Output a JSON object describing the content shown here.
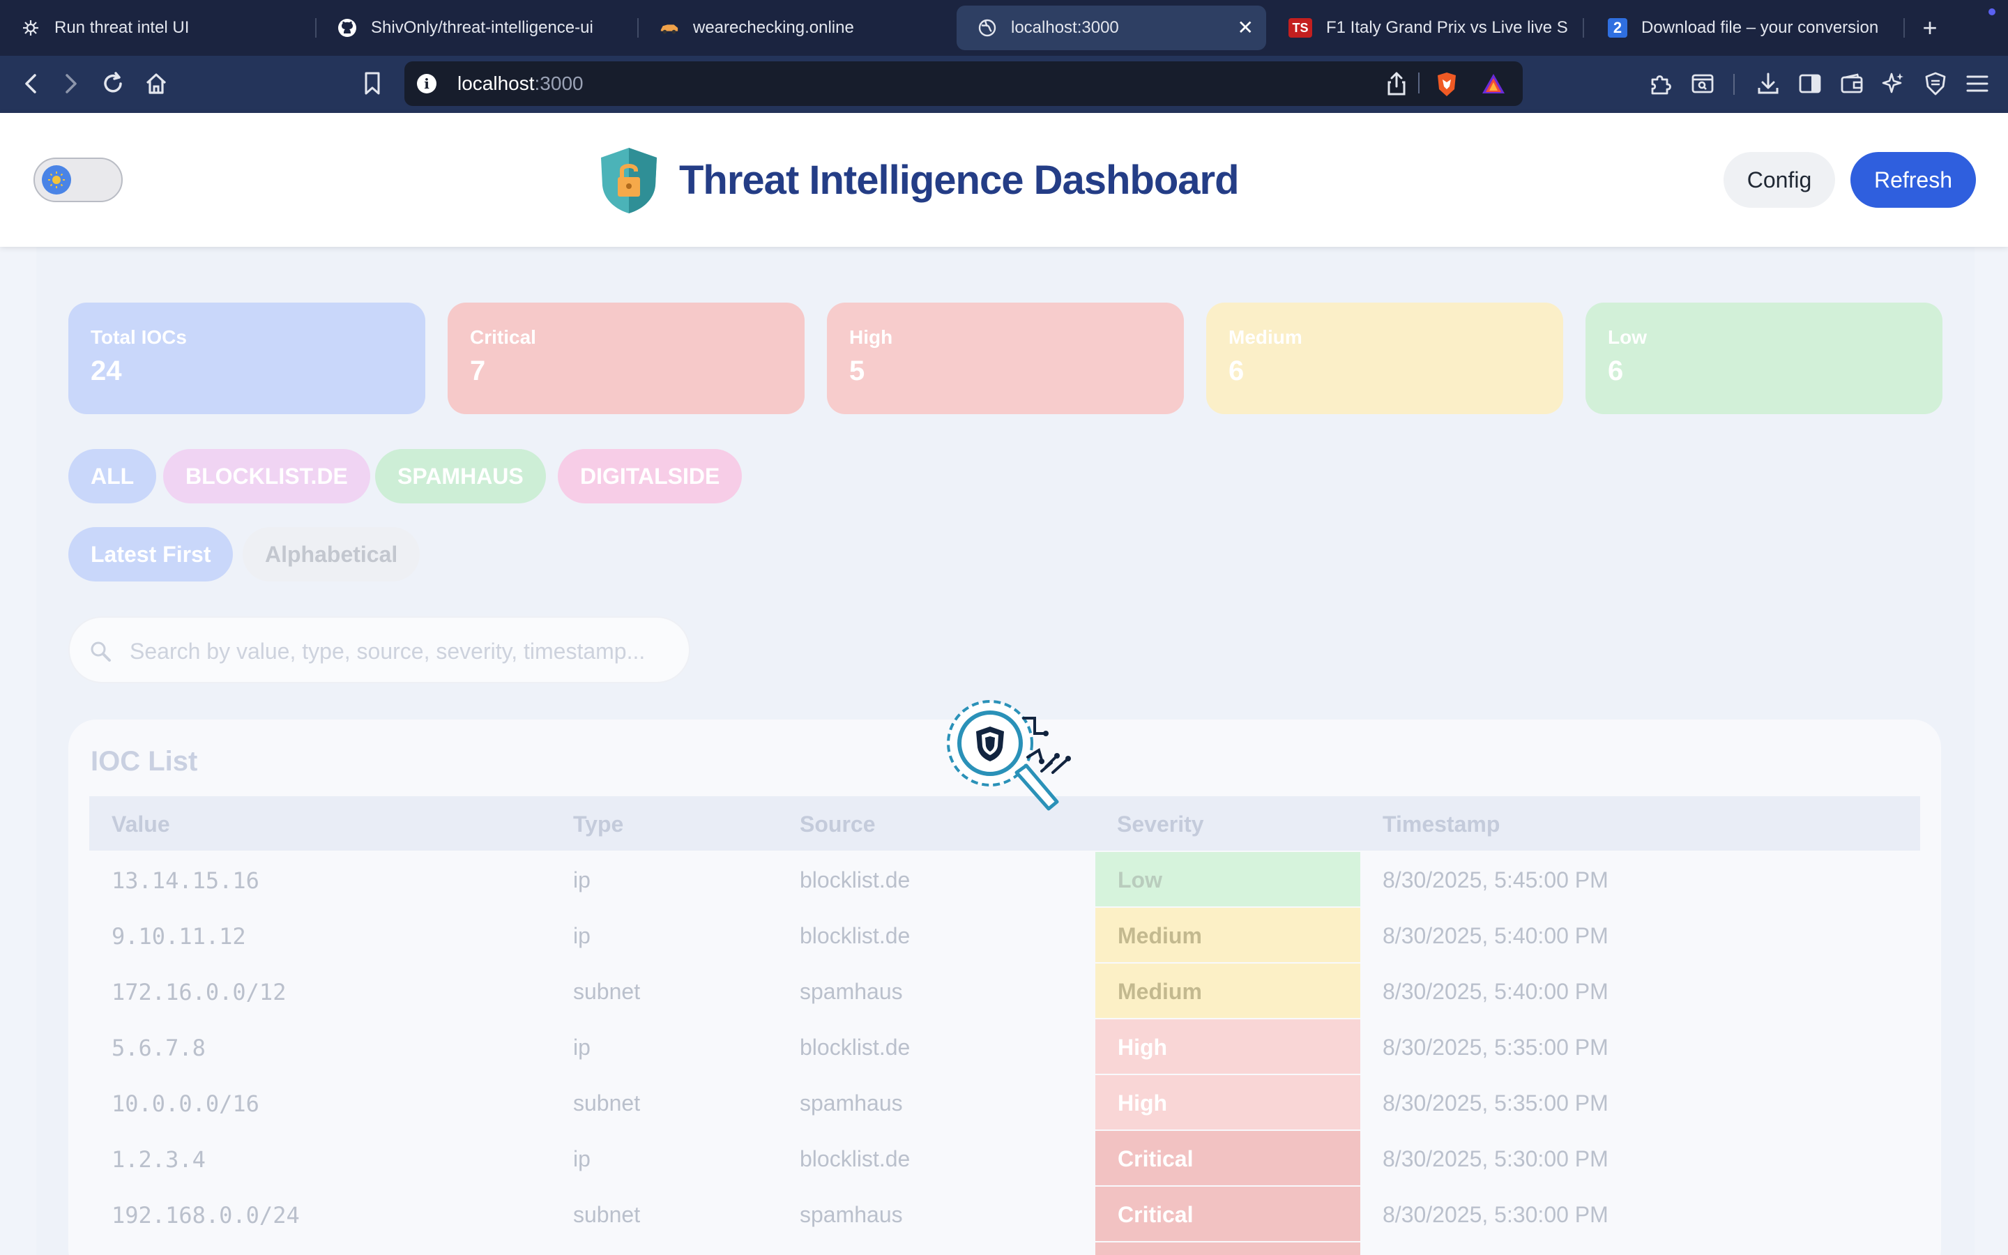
{
  "browser": {
    "tabs": [
      {
        "title": "Run threat intel UI",
        "icon": "openai-icon"
      },
      {
        "title": "ShivOnly/threat-intelligence-ui",
        "icon": "github-icon"
      },
      {
        "title": "wearechecking.online",
        "icon": "car-icon"
      },
      {
        "title": "localhost:3000",
        "icon": "globe-icon",
        "active": true
      },
      {
        "title": "F1 Italy Grand Prix vs Live live S",
        "icon": "ts-icon"
      },
      {
        "title": "Download file – your conversion",
        "icon": "download-2-icon"
      }
    ],
    "url_host": "localhost",
    "url_port": ":3000",
    "ts_badge": "TS",
    "two_badge": "2"
  },
  "header": {
    "title": "Threat Intelligence Dashboard",
    "config_label": "Config",
    "refresh_label": "Refresh"
  },
  "stats": [
    {
      "label": "Total IOCs",
      "value": "24",
      "color": "#c9d7fa"
    },
    {
      "label": "Critical",
      "value": "7",
      "color": "#f6c9c9"
    },
    {
      "label": "High",
      "value": "5",
      "color": "#f7cccc"
    },
    {
      "label": "Medium",
      "value": "6",
      "color": "#fbefc8"
    },
    {
      "label": "Low",
      "value": "6",
      "color": "#d2f0d8"
    }
  ],
  "source_filters": [
    "ALL",
    "BLOCKLIST.DE",
    "SPAMHAUS",
    "DIGITALSIDE"
  ],
  "sort_options": [
    "Latest First",
    "Alphabetical"
  ],
  "search": {
    "placeholder": "Search by value, type, source, severity, timestamp..."
  },
  "ioc_list": {
    "title": "IOC List",
    "columns": [
      "Value",
      "Type",
      "Source",
      "Severity",
      "Timestamp"
    ],
    "rows": [
      {
        "value": "13.14.15.16",
        "type": "ip",
        "source": "blocklist.de",
        "severity": "Low",
        "timestamp": "8/30/2025, 5:45:00 PM"
      },
      {
        "value": "9.10.11.12",
        "type": "ip",
        "source": "blocklist.de",
        "severity": "Medium",
        "timestamp": "8/30/2025, 5:40:00 PM"
      },
      {
        "value": "172.16.0.0/12",
        "type": "subnet",
        "source": "spamhaus",
        "severity": "Medium",
        "timestamp": "8/30/2025, 5:40:00 PM"
      },
      {
        "value": "5.6.7.8",
        "type": "ip",
        "source": "blocklist.de",
        "severity": "High",
        "timestamp": "8/30/2025, 5:35:00 PM"
      },
      {
        "value": "10.0.0.0/16",
        "type": "subnet",
        "source": "spamhaus",
        "severity": "High",
        "timestamp": "8/30/2025, 5:35:00 PM"
      },
      {
        "value": "1.2.3.4",
        "type": "ip",
        "source": "blocklist.de",
        "severity": "Critical",
        "timestamp": "8/30/2025, 5:30:00 PM"
      },
      {
        "value": "192.168.0.0/24",
        "type": "subnet",
        "source": "spamhaus",
        "severity": "Critical",
        "timestamp": "8/30/2025, 5:30:00 PM"
      }
    ]
  },
  "colors": {
    "accent": "#2f5fde",
    "title": "#243d86",
    "sev_low": "#d6f3dc",
    "sev_medium": "#fcf0c6",
    "sev_high": "#f9d6d6",
    "sev_critical": "#f2c2c2"
  }
}
